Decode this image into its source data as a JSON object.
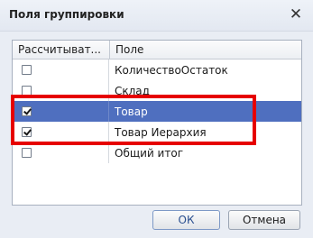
{
  "window": {
    "title": "Поля группировки",
    "close_glyph": "✕"
  },
  "grid": {
    "columns": [
      "Рассчитыват...",
      "Поле"
    ],
    "rows": [
      {
        "checked": false,
        "field": "КоличествоОстаток",
        "selected": false
      },
      {
        "checked": false,
        "field": "Склад",
        "selected": false
      },
      {
        "checked": true,
        "field": "Товар",
        "selected": true
      },
      {
        "checked": true,
        "field": "Товар Иерархия",
        "selected": false
      },
      {
        "checked": false,
        "field": "Общий итог",
        "selected": false
      }
    ]
  },
  "buttons": {
    "ok": "ОК",
    "cancel": "Отмена"
  },
  "colors": {
    "selection": "#4f6fbf",
    "highlight": "#e60000"
  }
}
